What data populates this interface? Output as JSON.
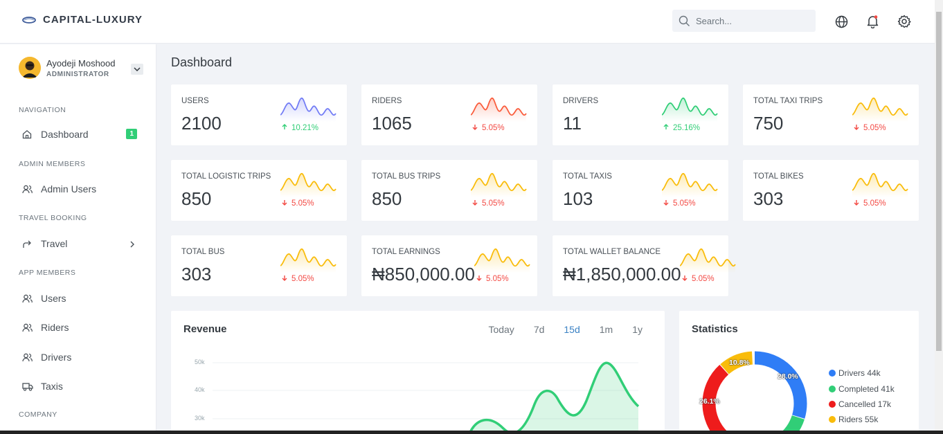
{
  "brand": {
    "name": "CAPITAL-LUXURY"
  },
  "search": {
    "placeholder": "Search..."
  },
  "header_icons": [
    "globe-icon",
    "bell-icon",
    "gear-icon"
  ],
  "user": {
    "name": "Ayodeji Moshood",
    "role": "ADMINISTRATOR"
  },
  "sidebar": {
    "sections": {
      "navigation": "NAVIGATION",
      "admin_members": "ADMIN MEMBERS",
      "travel_booking": "TRAVEL BOOKING",
      "app_members": "APP MEMBERS",
      "company": "COMPANY"
    },
    "items": {
      "dashboard": {
        "label": "Dashboard",
        "badge": "1",
        "icon": "home-icon"
      },
      "admin_users": {
        "label": "Admin Users",
        "icon": "users-icon"
      },
      "travel": {
        "label": "Travel",
        "icon": "share-arrow-icon"
      },
      "users": {
        "label": "Users",
        "icon": "users-icon"
      },
      "riders": {
        "label": "Riders",
        "icon": "users-icon"
      },
      "drivers": {
        "label": "Drivers",
        "icon": "users-icon"
      },
      "taxis": {
        "label": "Taxis",
        "icon": "truck-icon"
      }
    }
  },
  "page": {
    "title": "Dashboard"
  },
  "colors": {
    "blue": "#727cf5",
    "red": "#fa5c3c",
    "green": "#31ce77",
    "yellow": "#f9bc0b",
    "up": "#31ce77",
    "down": "#f34943"
  },
  "cards": [
    {
      "label": "USERS",
      "value": "2100",
      "trend": "10.21%",
      "direction": "up",
      "spark_color": "#727cf5"
    },
    {
      "label": "RIDERS",
      "value": "1065",
      "trend": "5.05%",
      "direction": "down",
      "spark_color": "#fa5c3c"
    },
    {
      "label": "DRIVERS",
      "value": "11",
      "trend": "25.16%",
      "direction": "up",
      "spark_color": "#31ce77"
    },
    {
      "label": "TOTAL TAXI TRIPS",
      "value": "750",
      "trend": "5.05%",
      "direction": "down",
      "spark_color": "#f9bc0b"
    },
    {
      "label": "TOTAL LOGISTIC TRIPS",
      "value": "850",
      "trend": "5.05%",
      "direction": "down",
      "spark_color": "#f9bc0b"
    },
    {
      "label": "TOTAL BUS TRIPS",
      "value": "850",
      "trend": "5.05%",
      "direction": "down",
      "spark_color": "#f9bc0b"
    },
    {
      "label": "TOTAL TAXIS",
      "value": "103",
      "trend": "5.05%",
      "direction": "down",
      "spark_color": "#f9bc0b"
    },
    {
      "label": "TOTAL BIKES",
      "value": "303",
      "trend": "5.05%",
      "direction": "down",
      "spark_color": "#f9bc0b"
    },
    {
      "label": "TOTAL BUS",
      "value": "303",
      "trend": "5.05%",
      "direction": "down",
      "spark_color": "#f9bc0b"
    },
    {
      "label": "TOTAL EARNINGS",
      "value": "₦850,000.00",
      "trend": "5.05%",
      "direction": "down",
      "spark_color": "#f9bc0b"
    },
    {
      "label": "TOTAL WALLET BALANCE",
      "value": "₦1,850,000.00",
      "trend": "5.05%",
      "direction": "down",
      "spark_color": "#f9bc0b"
    }
  ],
  "revenue": {
    "title": "Revenue",
    "filters": [
      "Today",
      "7d",
      "15d",
      "1m",
      "1y"
    ],
    "active_filter": "15d",
    "y_ticks": [
      "50k",
      "40k",
      "30k"
    ]
  },
  "statistics": {
    "title": "Statistics",
    "legend": [
      {
        "label": "Drivers 44k",
        "color": "#2f7df6"
      },
      {
        "label": "Completed 41k",
        "color": "#31ce77"
      },
      {
        "label": "Cancelled 17k",
        "color": "#ee1c1c"
      },
      {
        "label": "Riders 55k",
        "color": "#f9bc0b"
      }
    ],
    "percent_labels": [
      "28.0%",
      "26.1%",
      "10.8%"
    ]
  }
}
